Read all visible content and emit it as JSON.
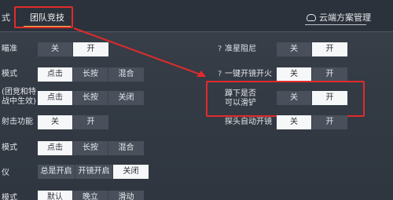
{
  "tabs": {
    "left_partial": "式",
    "team": "团队竞技",
    "cloud": "云端方案管理"
  },
  "left_rows": [
    {
      "label": "瞄准",
      "options": [
        "关",
        "开"
      ],
      "selected": 1
    },
    {
      "label": "模式",
      "options": [
        "点击",
        "长按",
        "混合"
      ],
      "selected": 0
    },
    {
      "label_lines": [
        "(团竞和特",
        "战中生效)"
      ],
      "options": [
        "点击",
        "长按",
        "关闭"
      ],
      "selected": 0
    },
    {
      "label": "射击功能",
      "options": [
        "关",
        "开"
      ],
      "selected": 0
    },
    {
      "label": "模式",
      "options": [
        "点击",
        "长按",
        "混合"
      ],
      "selected": 0
    },
    {
      "label": "仪",
      "options": [
        "总是开启",
        "开镜开启",
        "关闭"
      ],
      "selected": 2
    },
    {
      "label": "模式",
      "options": [
        "默认",
        "晚立",
        "滑动"
      ],
      "selected": 0
    }
  ],
  "right_rows": [
    {
      "label": "准星阻尼",
      "options": [
        "关",
        "开"
      ],
      "selected": 1,
      "has_help": true
    },
    {
      "label": "一键开镜开火",
      "options": [
        "关",
        "开"
      ],
      "selected": 0,
      "has_help": true
    },
    {
      "label_lines": [
        "蹲下是否",
        "可以滑铲"
      ],
      "options": [
        "关",
        "开"
      ],
      "selected": 1,
      "has_help": false
    },
    {
      "label": "探头自动开镜",
      "options": [
        "关",
        "开"
      ],
      "selected": 0,
      "has_help": false
    }
  ],
  "help_glyph": "?",
  "colors": {
    "highlight": "#e12b2b",
    "selected_bg": "#f6f7f9",
    "unselected_bg": "#49505b"
  }
}
